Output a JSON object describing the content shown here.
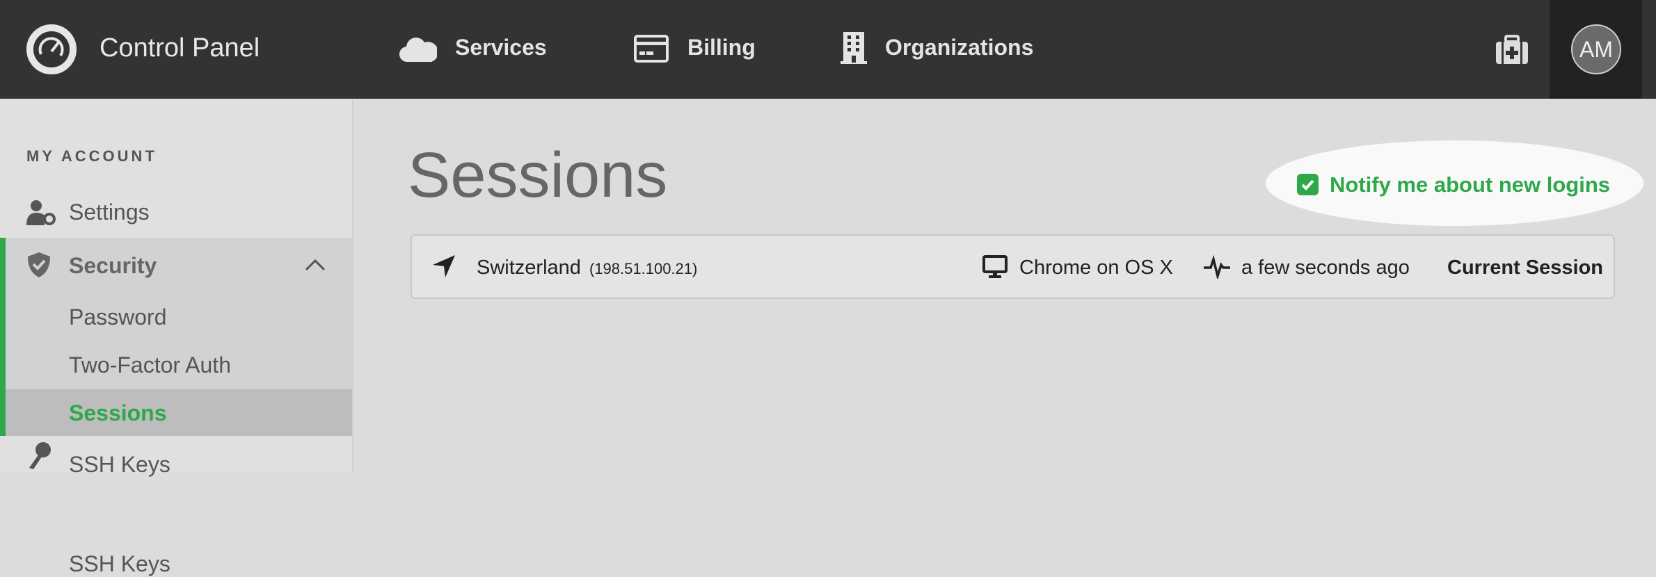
{
  "header": {
    "app_title": "Control Panel",
    "nav": [
      {
        "label": "Services",
        "icon": "cloud-icon"
      },
      {
        "label": "Billing",
        "icon": "credit-card-icon"
      },
      {
        "label": "Organizations",
        "icon": "building-icon"
      }
    ],
    "support_icon": "medkit-icon",
    "avatar_initials": "AM"
  },
  "sidebar": {
    "section_title": "MY ACCOUNT",
    "items": [
      {
        "label": "Settings",
        "icon": "user-gear-icon"
      },
      {
        "label": "Security",
        "icon": "shield-check-icon",
        "expanded": true,
        "children": [
          {
            "label": "Password"
          },
          {
            "label": "Two-Factor Auth"
          },
          {
            "label": "Sessions",
            "active": true
          }
        ]
      },
      {
        "label": "SSH Keys",
        "icon": "key-icon"
      }
    ]
  },
  "main": {
    "title": "Sessions",
    "notify": {
      "label": "Notify me about new logins",
      "checked": true
    },
    "sessions": [
      {
        "location": "Switzerland",
        "ip": "(198.51.100.21)",
        "device": "Chrome on OS X",
        "activity": "a few seconds ago",
        "status": "Current Session"
      }
    ]
  },
  "colors": {
    "accent": "#2ea84a",
    "header_bg": "#333333",
    "sidebar_bg": "#e0e0e0",
    "main_bg": "#dcdcdc"
  }
}
